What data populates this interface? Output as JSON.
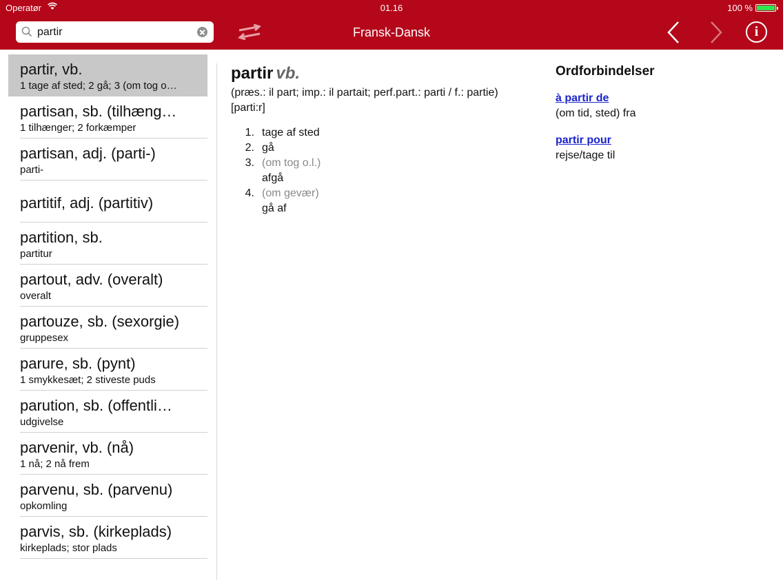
{
  "status": {
    "carrier": "Operatør",
    "time": "01.16",
    "battery": "100 %"
  },
  "header": {
    "search_value": "partir",
    "title": "Fransk-Dansk",
    "colors": {
      "bar": "#b5071a",
      "link": "#1a23c9"
    }
  },
  "list": [
    {
      "head": "partir, vb.",
      "sub": "1 tage af sted; 2 gå; 3 (om tog o…"
    },
    {
      "head": "partisan, sb. (tilhæng…",
      "sub": "1 tilhænger; 2 forkæmper"
    },
    {
      "head": "partisan, adj. (parti-)",
      "sub": "parti-"
    },
    {
      "head": "partitif, adj. (partitiv)",
      "sub": ""
    },
    {
      "head": "partition, sb.",
      "sub": "partitur"
    },
    {
      "head": "partout, adv. (overalt)",
      "sub": "overalt"
    },
    {
      "head": "partouze, sb. (sexorgie)",
      "sub": "gruppesex"
    },
    {
      "head": "parure, sb. (pynt)",
      "sub": "1 smykkesæt; 2 stiveste puds"
    },
    {
      "head": "parution, sb. (offentli…",
      "sub": "udgivelse"
    },
    {
      "head": "parvenir, vb. (nå)",
      "sub": "1 nå; 2 nå frem"
    },
    {
      "head": "parvenu, sb. (parvenu)",
      "sub": "opkomling"
    },
    {
      "head": "parvis, sb. (kirkeplads)",
      "sub": "kirkeplads; stor plads"
    }
  ],
  "entry": {
    "headword": "partir",
    "pos": "vb.",
    "inflection": "(præs.: il part; imp.: il partait; perf.part.: parti / f.: partie)",
    "pronunciation": "[parti:r]",
    "senses": [
      {
        "num": "1.",
        "note": "",
        "text": "tage af sted"
      },
      {
        "num": "2.",
        "note": "",
        "text": "gå"
      },
      {
        "num": "3.",
        "note": "(om tog o.l.)",
        "text": "afgå"
      },
      {
        "num": "4.",
        "note": "(om gevær)",
        "text": "gå af"
      }
    ]
  },
  "phrases": {
    "title": "Ordforbindelser",
    "items": [
      {
        "phrase": "à partir de",
        "meaning": "(om tid, sted) fra"
      },
      {
        "phrase": "partir pour",
        "meaning": "rejse/tage til"
      }
    ]
  },
  "icons": [
    "wifi-icon",
    "battery-icon",
    "search-icon",
    "clear-icon",
    "swap-direction-icon",
    "back-chevron-icon",
    "forward-chevron-icon",
    "info-icon"
  ]
}
